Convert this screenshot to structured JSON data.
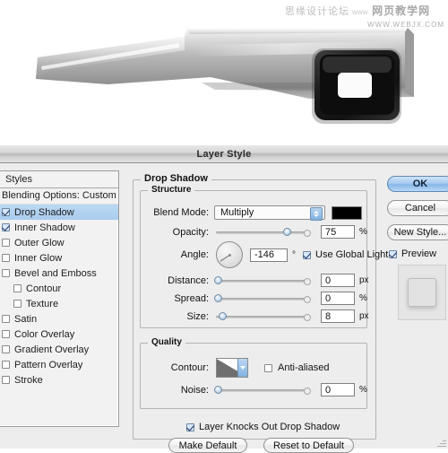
{
  "watermark": {
    "cn_forum": "思缘设计论坛",
    "www": "www.",
    "cn_site": "网页教学网",
    "url": "WWW.WEBJX.COM"
  },
  "dialog": {
    "title": "Layer Style"
  },
  "styles_panel": {
    "header": "Styles",
    "blending_options": "Blending Options: Custom",
    "effects": [
      {
        "label": "Drop Shadow",
        "checked": true,
        "selected": true,
        "indent": false
      },
      {
        "label": "Inner Shadow",
        "checked": true,
        "selected": false,
        "indent": false
      },
      {
        "label": "Outer Glow",
        "checked": false,
        "selected": false,
        "indent": false
      },
      {
        "label": "Inner Glow",
        "checked": false,
        "selected": false,
        "indent": false
      },
      {
        "label": "Bevel and Emboss",
        "checked": false,
        "selected": false,
        "indent": false
      },
      {
        "label": "Contour",
        "checked": false,
        "selected": false,
        "indent": true
      },
      {
        "label": "Texture",
        "checked": false,
        "selected": false,
        "indent": true
      },
      {
        "label": "Satin",
        "checked": false,
        "selected": false,
        "indent": false
      },
      {
        "label": "Color Overlay",
        "checked": false,
        "selected": false,
        "indent": false
      },
      {
        "label": "Gradient Overlay",
        "checked": false,
        "selected": false,
        "indent": false
      },
      {
        "label": "Pattern Overlay",
        "checked": false,
        "selected": false,
        "indent": false
      },
      {
        "label": "Stroke",
        "checked": false,
        "selected": false,
        "indent": false
      }
    ]
  },
  "drop_shadow": {
    "group_label": "Drop Shadow",
    "structure": {
      "group_label": "Structure",
      "blend_mode_label": "Blend Mode:",
      "blend_mode_value": "Multiply",
      "shadow_color": "#000000",
      "opacity_label": "Opacity:",
      "opacity_value": "75",
      "opacity_unit": "%",
      "opacity_percent": 75,
      "angle_label": "Angle:",
      "angle_value": "-146",
      "angle_unit": "°",
      "angle_degrees": -146,
      "global_light_label": "Use Global Light",
      "global_light_checked": true,
      "distance_label": "Distance:",
      "distance_value": "0",
      "distance_unit": "px",
      "distance_percent": 2,
      "spread_label": "Spread:",
      "spread_value": "0",
      "spread_unit": "%",
      "spread_percent": 2,
      "size_label": "Size:",
      "size_value": "8",
      "size_unit": "px",
      "size_percent": 7
    },
    "quality": {
      "group_label": "Quality",
      "contour_label": "Contour:",
      "anti_aliased_label": "Anti-aliased",
      "anti_aliased_checked": false,
      "noise_label": "Noise:",
      "noise_value": "0",
      "noise_unit": "%",
      "noise_percent": 2
    },
    "knockout_label": "Layer Knocks Out Drop Shadow",
    "knockout_checked": true,
    "make_default": "Make Default",
    "reset_to_default": "Reset to Default"
  },
  "actions": {
    "ok": "OK",
    "cancel": "Cancel",
    "new_style": "New Style...",
    "preview_label": "Preview",
    "preview_checked": true
  },
  "colors": {
    "selection_blue": "#a8cbee",
    "dialog_bg": "#ededed",
    "titlebar": "#cfcfcf",
    "shadow_swatch": "#000000"
  }
}
